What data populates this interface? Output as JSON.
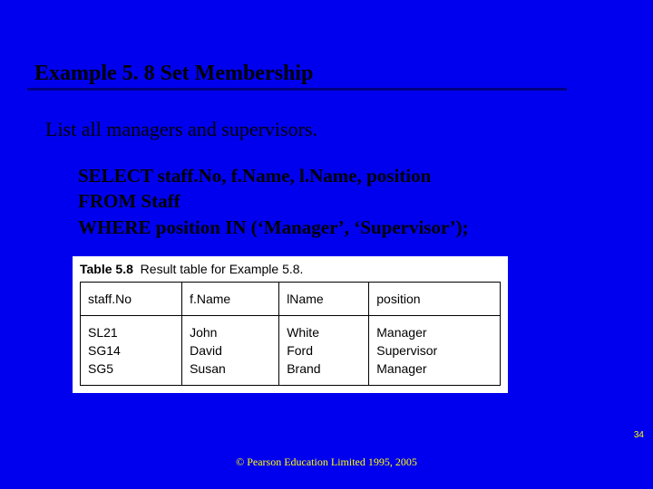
{
  "title": "Example 5. 8  Set Membership",
  "description": "List all managers and supervisors.",
  "sql": {
    "line1": "SELECT staff.No, f.Name, l.Name, position",
    "line2": "FROM Staff",
    "line3": "WHERE position IN (‘Manager’, ‘Supervisor’);"
  },
  "table": {
    "caption_label": "Table 5.8",
    "caption_text": "Result table for Example 5.8.",
    "headers": [
      "staff.No",
      "f.Name",
      "lName",
      "position"
    ],
    "rows": [
      [
        "SL21",
        "John",
        "White",
        "Manager"
      ],
      [
        "SG14",
        "David",
        "Ford",
        "Supervisor"
      ],
      [
        "SG5",
        "Susan",
        "Brand",
        "Manager"
      ]
    ]
  },
  "footer": "© Pearson Education Limited 1995, 2005",
  "page_number": "34"
}
